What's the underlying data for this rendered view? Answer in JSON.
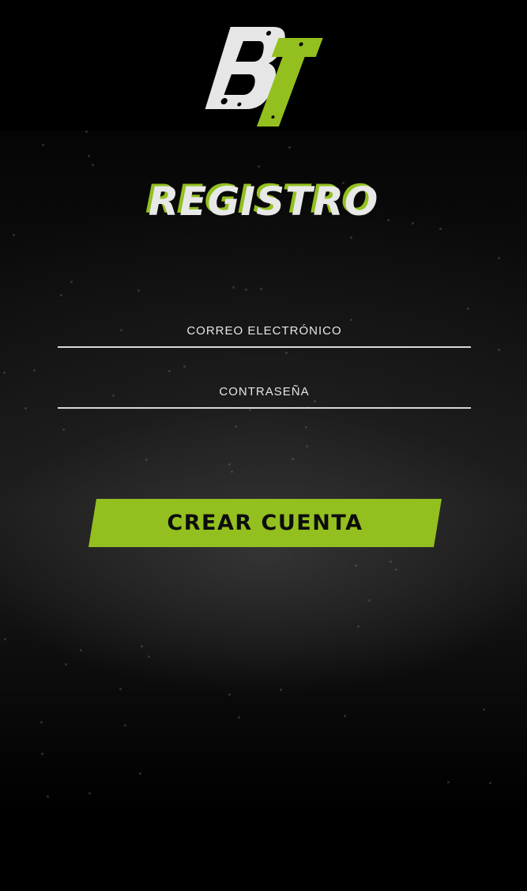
{
  "brand": {
    "logo_text": "BT",
    "logo_icon": "bt-logo-icon",
    "colors": {
      "accent": "#93c01f",
      "logo_light": "#e6e6e6",
      "background": "#000000"
    }
  },
  "page": {
    "title": "REGISTRO"
  },
  "form": {
    "email_placeholder": "CORREO ELECTRÓNICO",
    "password_placeholder": "CONTRASEÑA",
    "submit_label": "CREAR CUENTA"
  }
}
